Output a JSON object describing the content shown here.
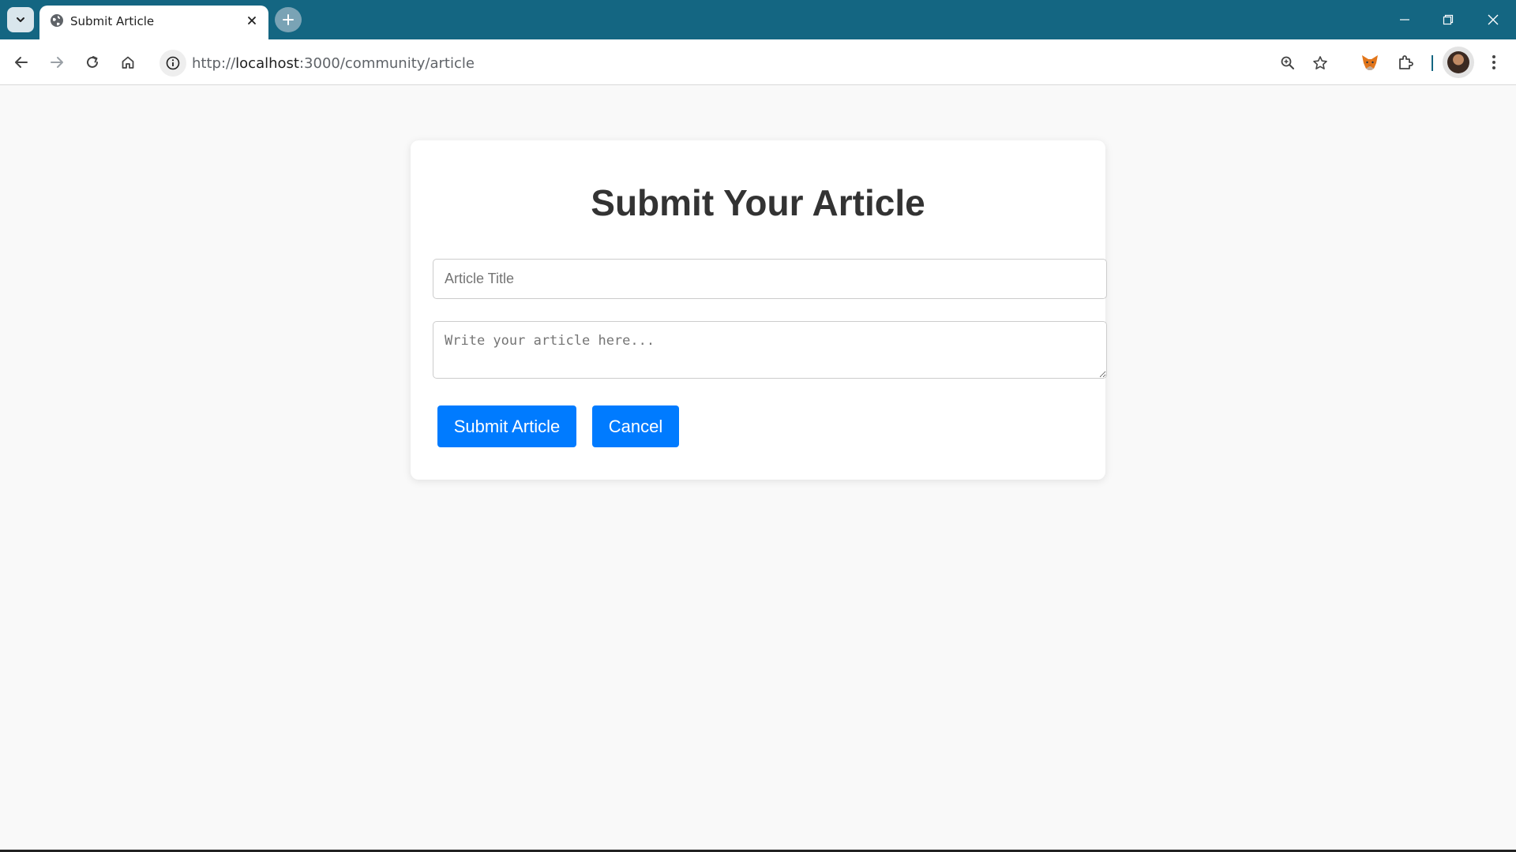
{
  "browser": {
    "tab": {
      "title": "Submit Article",
      "favicon": "globe-icon",
      "close_icon": "close-icon"
    },
    "new_tab_icon": "plus-icon",
    "window_controls": [
      "minimize-icon",
      "restore-icon",
      "close-icon"
    ],
    "url": {
      "scheme": "http://",
      "host": "localhost",
      "rest": ":3000/community/article"
    },
    "toolbar_icons": [
      "back-icon",
      "forward-icon",
      "reload-icon",
      "home-icon",
      "info-icon",
      "zoom-icon",
      "star-icon",
      "metamask-fox-icon",
      "extensions-icon",
      "profile-avatar",
      "menu-icon"
    ]
  },
  "form": {
    "heading": "Submit Your Article",
    "title_placeholder": "Article Title",
    "title_value": "",
    "body_placeholder": "Write your article here...",
    "body_value": "",
    "submit_label": "Submit Article",
    "cancel_label": "Cancel"
  },
  "colors": {
    "browser_frame": "#146682",
    "primary_button": "#007bff",
    "page_background": "#f9f9f9"
  }
}
